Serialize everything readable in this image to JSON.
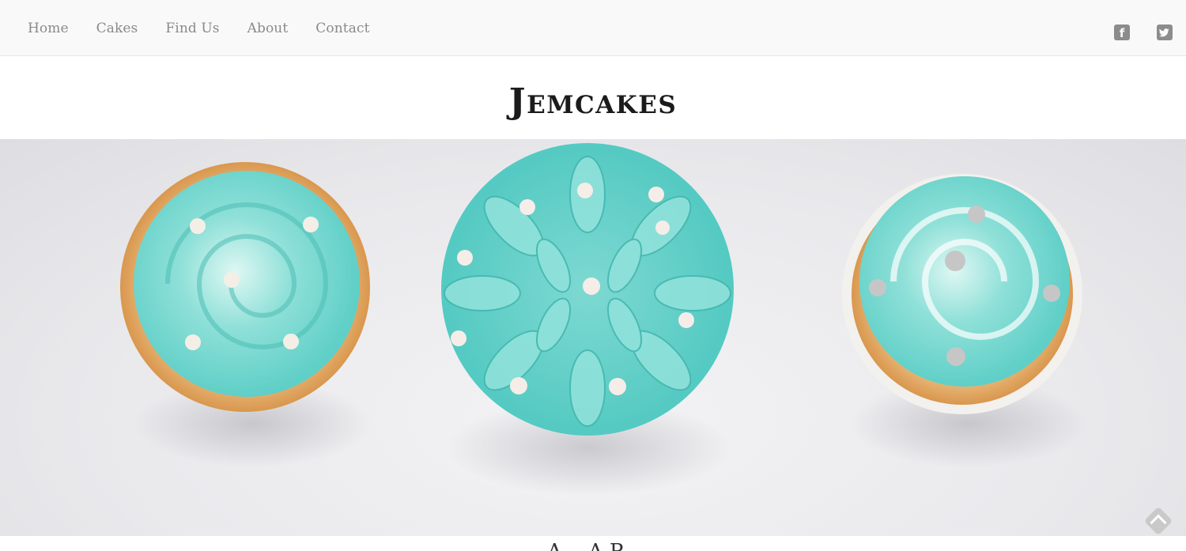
{
  "nav": {
    "items": [
      {
        "label": "Home"
      },
      {
        "label": "Cakes"
      },
      {
        "label": "Find Us"
      },
      {
        "label": "About"
      },
      {
        "label": "Contact"
      }
    ]
  },
  "social": {
    "facebook_icon": "facebook-icon",
    "twitter_icon": "twitter-icon"
  },
  "brand": {
    "title": "Jemcakes"
  },
  "hero": {
    "image_icon": "cupcakes-photo",
    "frosting_color": "#5fd3cc",
    "cake_color": "#e0a35c"
  },
  "section": {
    "partial_heading": "A... A P..."
  }
}
